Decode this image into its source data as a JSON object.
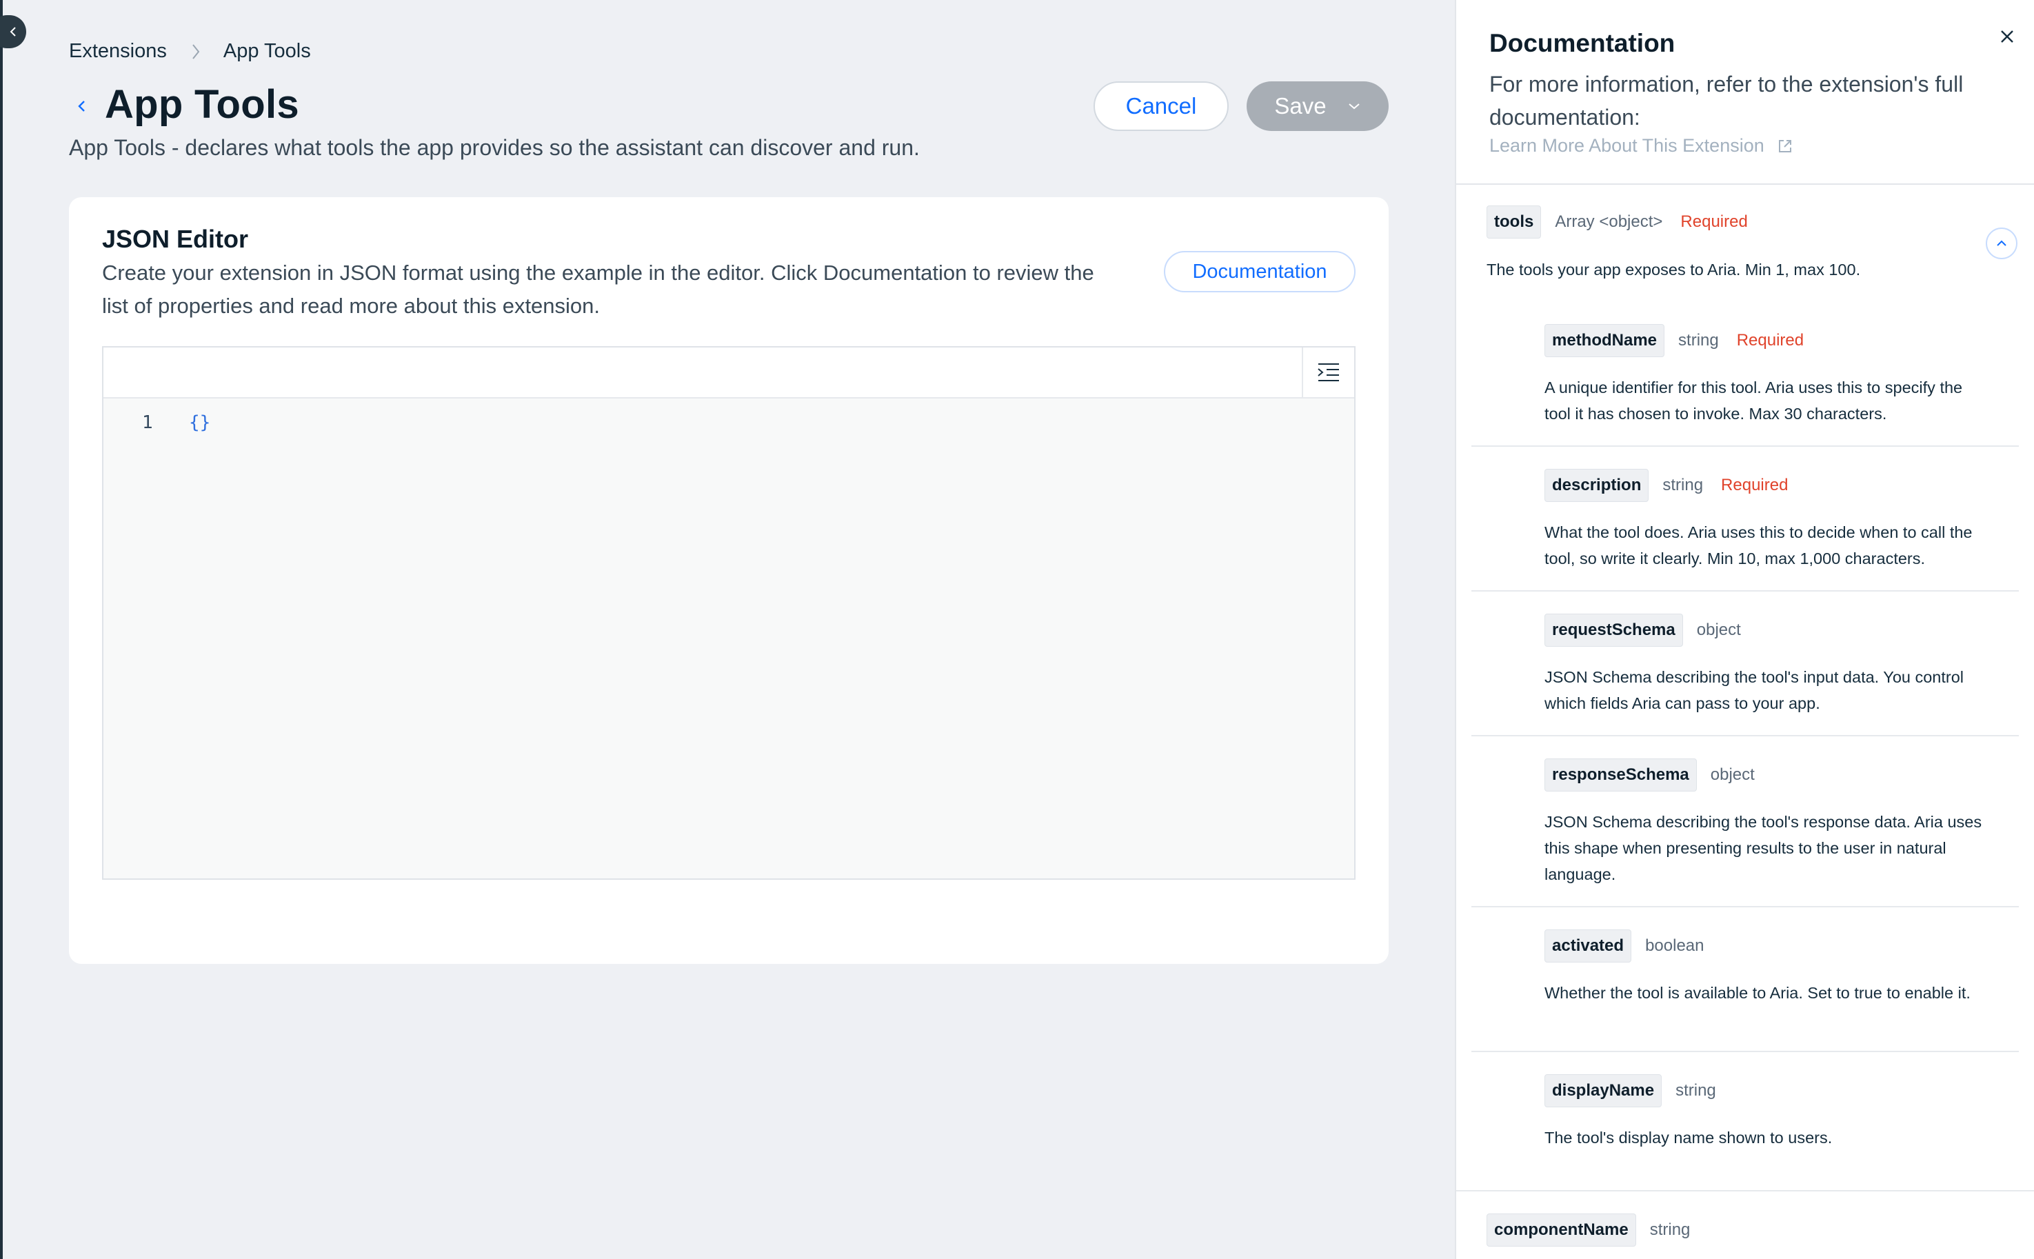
{
  "breadcrumb": {
    "parent": "Extensions",
    "current": "App Tools"
  },
  "page": {
    "title": "App Tools",
    "subtitle": "App Tools - declares what tools the app provides so the assistant can discover and run."
  },
  "actions": {
    "cancel_label": "Cancel",
    "save_label": "Save"
  },
  "editor": {
    "title": "JSON Editor",
    "description": "Create your extension in JSON format using the example in the editor. Click Documentation to review the list of properties and read more about this extension.",
    "documentation_button": "Documentation",
    "line_number": "1",
    "code": "{}"
  },
  "doc_panel": {
    "title": "Documentation",
    "intro": "For more information, refer to the extension's full documentation:",
    "link_label": "Learn More About This Extension",
    "properties": [
      {
        "name": "tools",
        "type": "Array <object>",
        "required": "Required",
        "description": "The tools your app exposes to Aria. Min 1, max 100."
      },
      {
        "name": "methodName",
        "type": "string",
        "required": "Required",
        "description": "A unique identifier for this tool. Aria uses this to specify the tool it has chosen to invoke. Max 30 characters."
      },
      {
        "name": "description",
        "type": "string",
        "required": "Required",
        "description": "What the tool does. Aria uses this to decide when to call the tool, so write it clearly. Min 10, max 1,000 characters."
      },
      {
        "name": "requestSchema",
        "type": "object",
        "description": "JSON Schema describing the tool's input data. You control which fields Aria can pass to your app."
      },
      {
        "name": "responseSchema",
        "type": "object",
        "description": "JSON Schema describing the tool's response data. Aria uses this shape when presenting results to the user in natural language."
      },
      {
        "name": "activated",
        "type": "boolean",
        "description_pre": "Whether the tool is available to Aria. Set to ",
        "description_code": "true",
        "description_post": " to enable it."
      },
      {
        "name": "displayName",
        "type": "string",
        "description": "The tool's display name shown to users."
      },
      {
        "name": "componentName",
        "type": "string"
      }
    ]
  },
  "colors": {
    "accent": "#116dff",
    "required": "#e0432b",
    "save_disabled": "#a8aeb5"
  }
}
